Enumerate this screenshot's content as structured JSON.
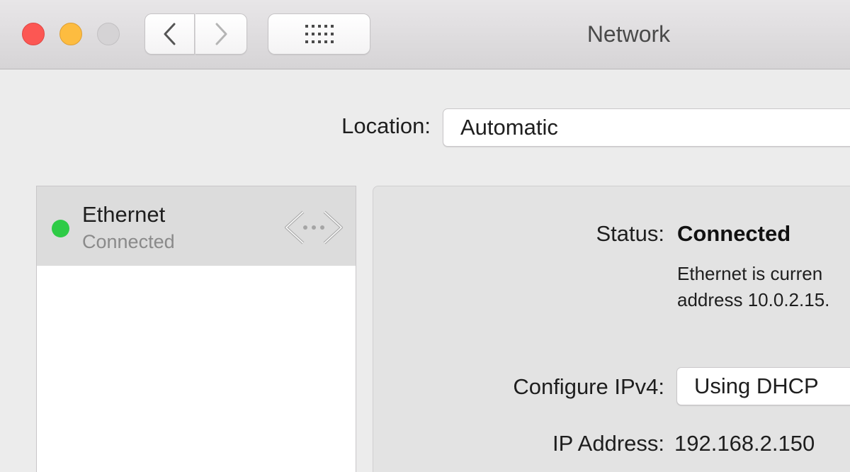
{
  "window": {
    "title": "Network"
  },
  "toolbar": {
    "back_icon": "chevron-left-icon",
    "forward_icon": "chevron-right-icon",
    "grid_icon": "grid-icon"
  },
  "location": {
    "label": "Location:",
    "value": "Automatic"
  },
  "services": [
    {
      "name": "Ethernet",
      "status": "Connected",
      "status_color": "#2ecb46",
      "icon": "ethernet-icon"
    }
  ],
  "detail": {
    "status_label": "Status:",
    "status_value": "Connected",
    "status_description_line1": "Ethernet is curren",
    "status_description_line2": "address 10.0.2.15.",
    "configure_ipv4_label": "Configure IPv4:",
    "configure_ipv4_value": "Using DHCP",
    "ip_address_label": "IP Address:",
    "ip_address_value": "192.168.2.150"
  },
  "colors": {
    "close": "#fc5753",
    "minimize": "#fdbc40",
    "zoom_disabled": "#d5d3d5"
  }
}
